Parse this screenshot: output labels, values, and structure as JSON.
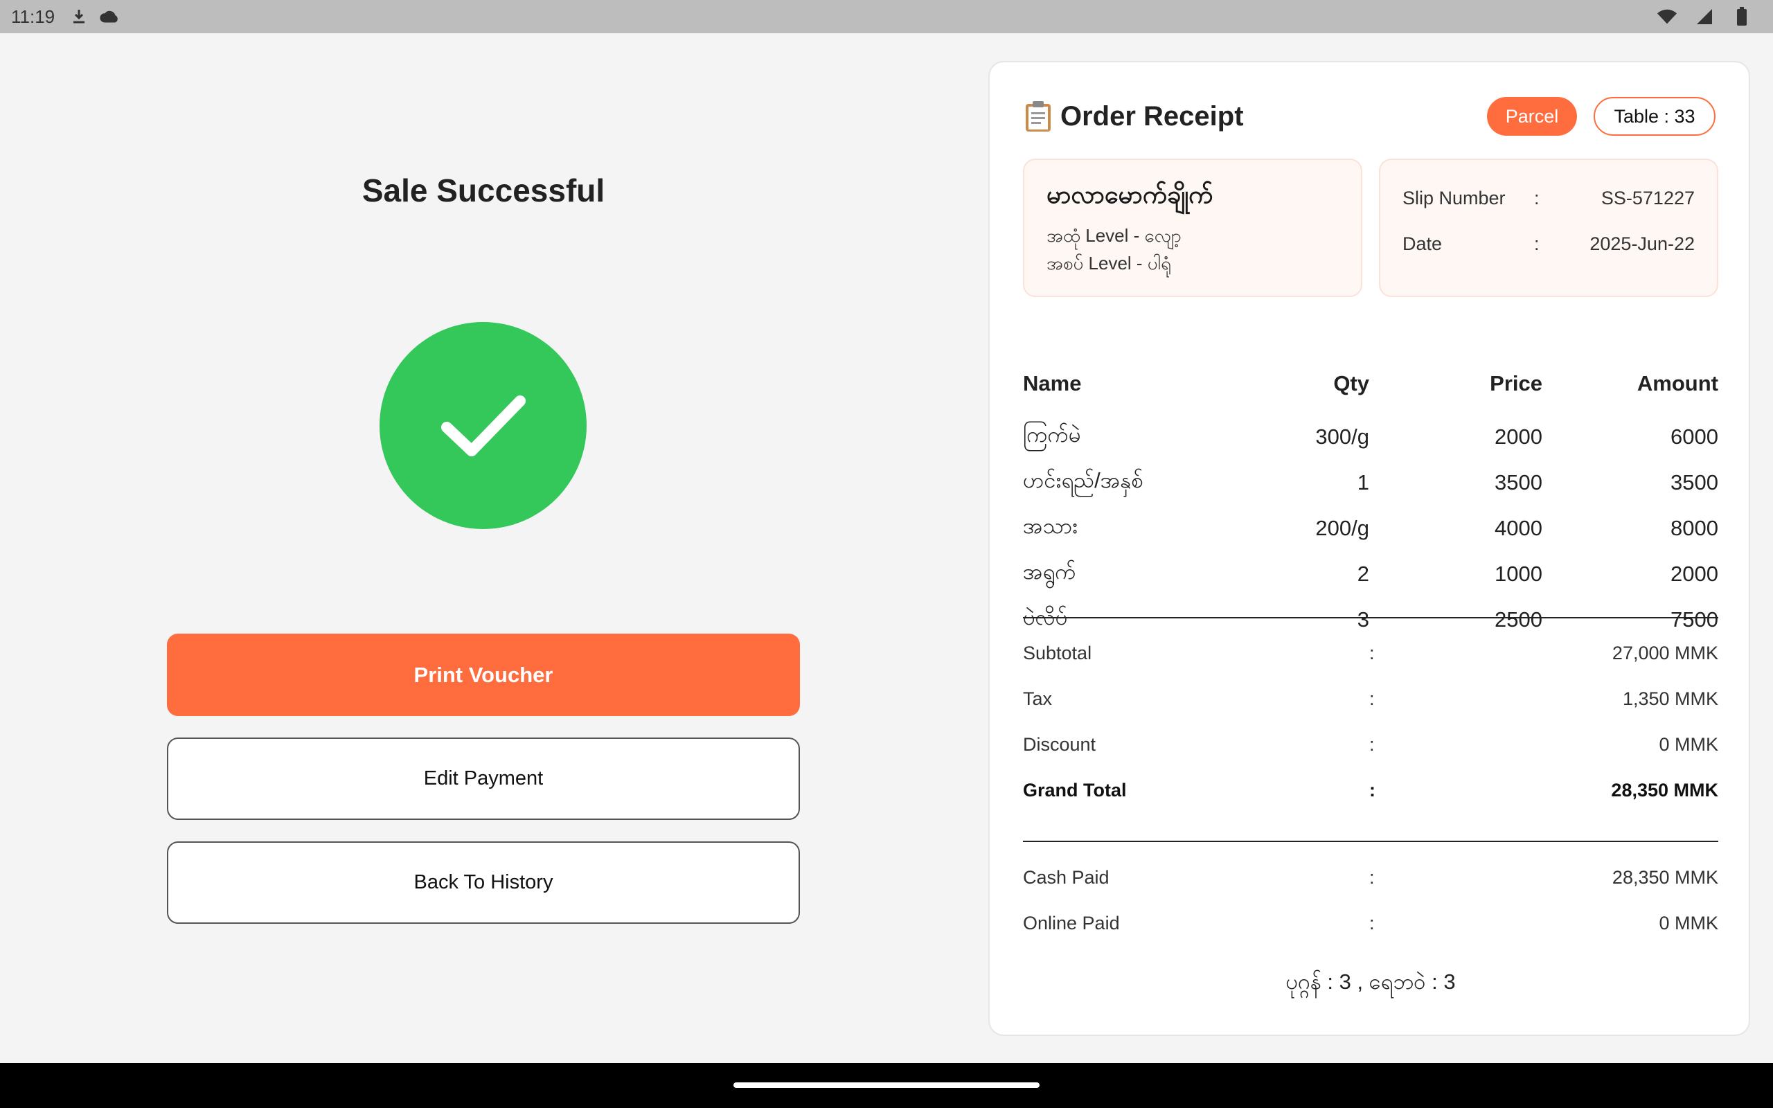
{
  "status_bar": {
    "time": "11:19"
  },
  "left": {
    "title": "Sale Successful",
    "print_label": "Print Voucher",
    "edit_label": "Edit Payment",
    "back_label": "Back To History"
  },
  "receipt": {
    "title": "Order Receipt",
    "parcel_label": "Parcel",
    "table_label": "Table : 33",
    "shop_name": "မာလာမောက်ချိုက်",
    "level1": "အထုံ Level - လျော့",
    "level2": "အစပ် Level - ပါရုံ",
    "slip_key": "Slip Number",
    "slip_value": "SS-571227",
    "date_key": "Date",
    "date_value": "2025-Jun-22",
    "columns": [
      "Name",
      "Qty",
      "Price",
      "Amount"
    ],
    "rows": [
      [
        "ကြက်မဲ",
        "300/g",
        "2000",
        "6000"
      ],
      [
        "ဟင်းရည်/အနှစ်",
        "1",
        "3500",
        "3500"
      ],
      [
        "အသား",
        "200/g",
        "4000",
        "8000"
      ],
      [
        "အရွက်",
        "2",
        "1000",
        "2000"
      ],
      [
        "ပဲလိပ်",
        "3",
        "2500",
        "7500"
      ]
    ],
    "summary": {
      "subtotal_k": "Subtotal",
      "subtotal_v": "27,000 MMK",
      "tax_k": "Tax",
      "tax_v": "1,350 MMK",
      "discount_k": "Discount",
      "discount_v": "0 MMK",
      "grand_k": "Grand Total",
      "grand_v": "28,350 MMK",
      "cash_k": "Cash Paid",
      "cash_v": "28,350 MMK",
      "online_k": "Online Paid",
      "online_v": "0 MMK"
    },
    "colon": ":",
    "footer": "ပုဂ္ဂန် : 3 , ရေဘဝဲ : 3"
  }
}
